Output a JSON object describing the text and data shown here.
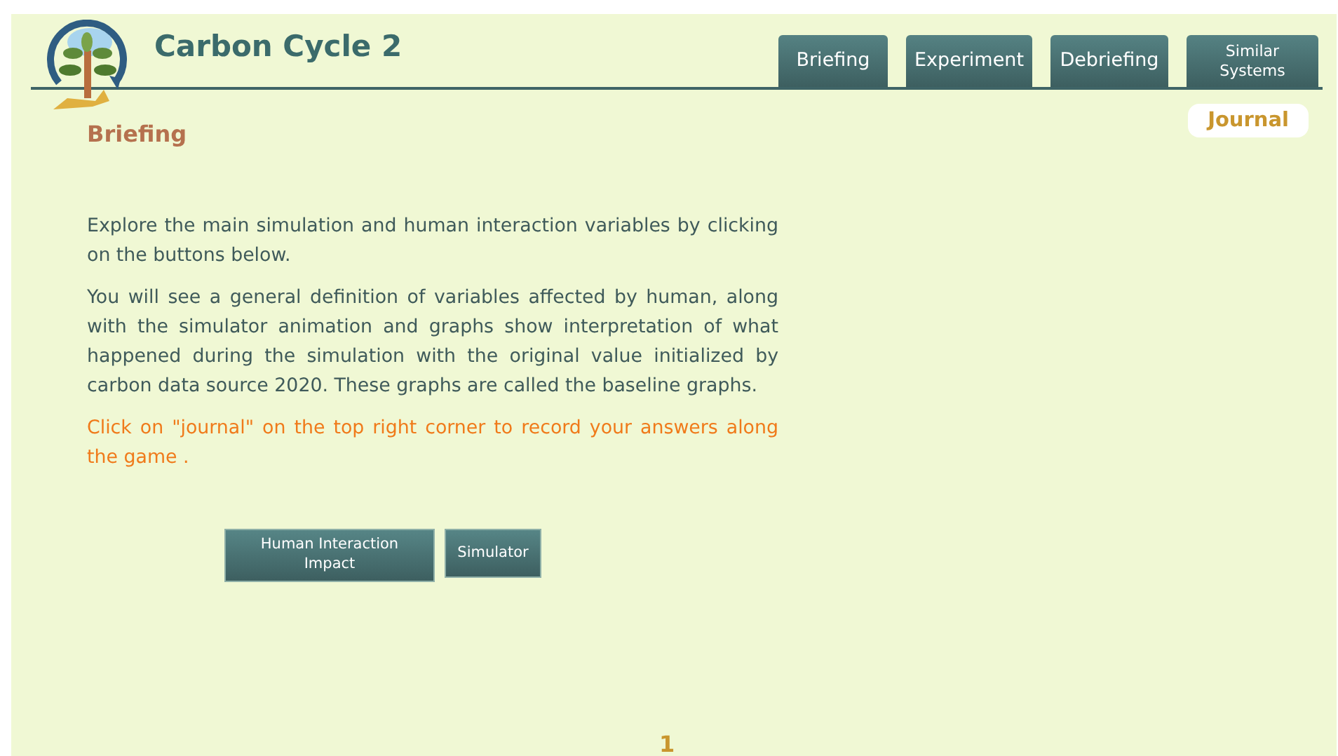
{
  "header": {
    "title": "Carbon Cycle 2"
  },
  "tabs": [
    {
      "label": "Briefing"
    },
    {
      "label": "Experiment"
    },
    {
      "label": "Debriefing"
    },
    {
      "label": "Similar Systems"
    }
  ],
  "journal": {
    "label": "Journal"
  },
  "section": {
    "heading": "Briefing"
  },
  "paragraphs": [
    {
      "kind": "text",
      "text": "Explore the main simulation and human interaction variables by clicking on the buttons below."
    },
    {
      "kind": "text",
      "text": "You will see a general definition of variables affected by human, along with the simulator animation and graphs show interpretation of what happened during the simulation with the original value initialized by carbon data source 2020. These graphs are called the baseline graphs."
    },
    {
      "kind": "note",
      "text": "Click on \"journal\" on the top right corner to record your answers along the game ."
    }
  ],
  "buttons": [
    {
      "label": "Human Interaction Impact"
    },
    {
      "label": "Simulator"
    }
  ],
  "page_number": "1"
}
